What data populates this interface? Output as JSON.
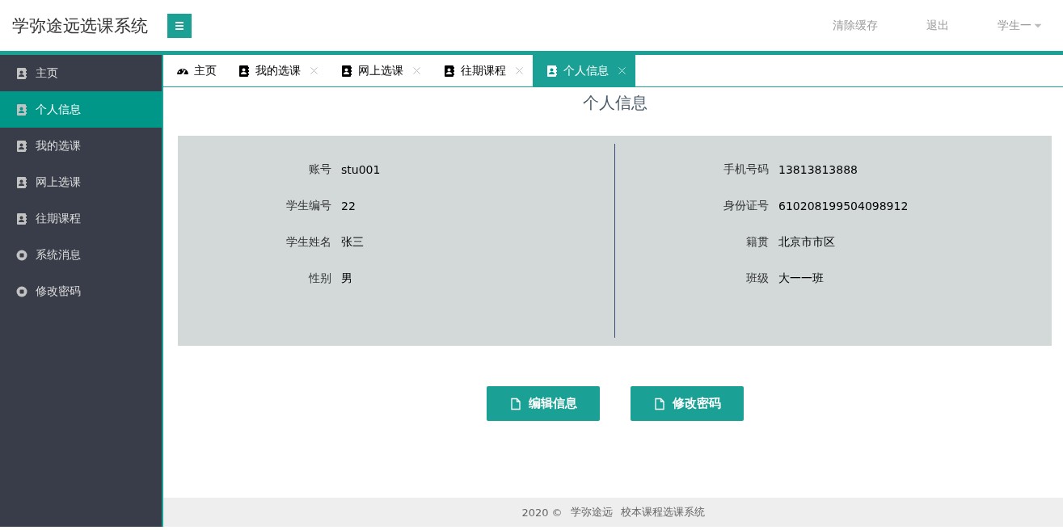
{
  "header": {
    "title": "学弥途远选课系统",
    "links": [
      "清除缓存",
      "退出"
    ],
    "user": "学生一"
  },
  "sidebar": {
    "items": [
      {
        "label": "主页",
        "kind": "book",
        "selected": false
      },
      {
        "label": "个人信息",
        "kind": "book",
        "selected": true
      },
      {
        "label": "我的选课",
        "kind": "book",
        "selected": false
      },
      {
        "label": "网上选课",
        "kind": "book",
        "selected": false
      },
      {
        "label": "往期课程",
        "kind": "book",
        "selected": false
      },
      {
        "label": "系统消息",
        "kind": "dot",
        "selected": false
      },
      {
        "label": "修改密码",
        "kind": "dot",
        "selected": false
      }
    ]
  },
  "tabs": [
    {
      "label": "主页",
      "kind": "gauge",
      "closable": false,
      "selected": false
    },
    {
      "label": "我的选课",
      "kind": "book",
      "closable": true,
      "selected": false
    },
    {
      "label": "网上选课",
      "kind": "book",
      "closable": true,
      "selected": false
    },
    {
      "label": "往期课程",
      "kind": "book",
      "closable": true,
      "selected": false
    },
    {
      "label": "个人信息",
      "kind": "book",
      "closable": true,
      "selected": true
    }
  ],
  "page_title": "个人信息",
  "info": {
    "left": [
      {
        "label": "账号",
        "value": "stu001"
      },
      {
        "label": "学生编号",
        "value": "22"
      },
      {
        "label": "学生姓名",
        "value": "张三"
      },
      {
        "label": "性别",
        "value": "男"
      }
    ],
    "right": [
      {
        "label": "手机号码",
        "value": "13813813888"
      },
      {
        "label": "身份证号",
        "value": "610208199504098912"
      },
      {
        "label": "籍贯",
        "value": "北京市市区"
      },
      {
        "label": "班级",
        "value": "大一一班"
      }
    ]
  },
  "buttons": [
    "编辑信息",
    "修改密码"
  ],
  "footer": {
    "year": "2020 ©",
    "org": "学弥途远",
    "system": "校本课程选课系统"
  }
}
